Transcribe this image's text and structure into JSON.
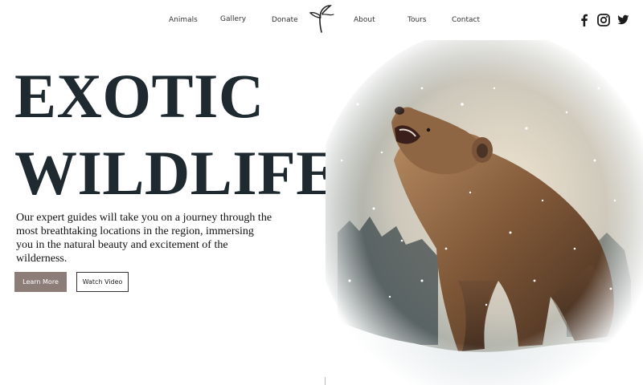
{
  "nav": {
    "items": [
      {
        "label": "Animals"
      },
      {
        "label": "Gallery"
      },
      {
        "label": "Donate"
      },
      {
        "label": "About"
      },
      {
        "label": "Tours"
      },
      {
        "label": "Contact"
      }
    ],
    "logo_icon": "sprout-icon"
  },
  "social": {
    "icons": [
      "facebook-icon",
      "instagram-icon",
      "twitter-icon"
    ]
  },
  "hero": {
    "title_line1": "EXOTIC",
    "title_line2": "WILDLIFE",
    "description": "Our expert guides will take you on a journey through the most breathtaking locations in the region, immersing you in the natural beauty and excitement of the wilderness.",
    "primary_button": "Learn More",
    "secondary_button": "Watch Video"
  },
  "colors": {
    "title": "#1e2a30",
    "primary_button_bg": "#8c7d78",
    "background": "#ffffff"
  }
}
